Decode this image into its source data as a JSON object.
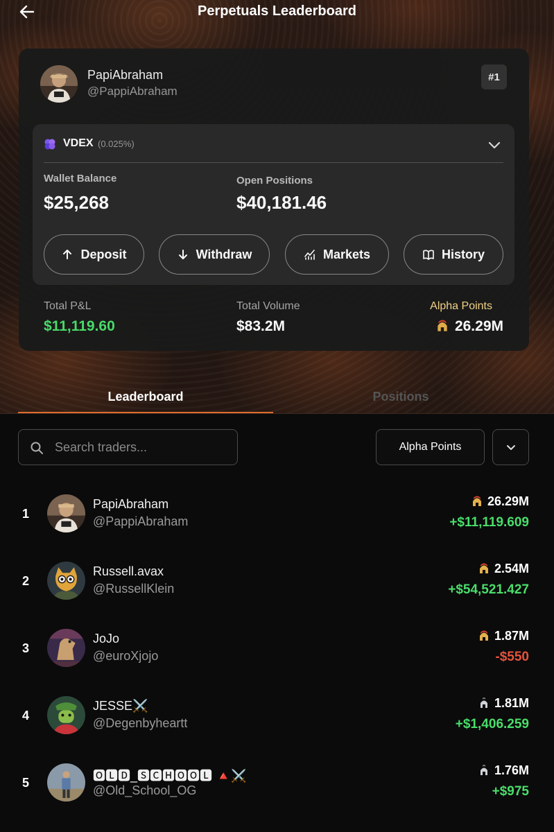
{
  "header": {
    "title": "Perpetuals Leaderboard"
  },
  "profile": {
    "name": "PapiAbraham",
    "handle": "@PappiAbraham",
    "rank": "#1",
    "exchange": {
      "name": "VDEX",
      "fee": "(0.025%)"
    },
    "wallet_balance": {
      "label": "Wallet Balance",
      "value": "$25,268"
    },
    "open_positions": {
      "label": "Open Positions",
      "value": "$40,181.46"
    },
    "actions": [
      {
        "label": "Deposit",
        "icon": "arrow-up-icon"
      },
      {
        "label": "Withdraw",
        "icon": "arrow-down-icon"
      },
      {
        "label": "Markets",
        "icon": "chart-icon"
      },
      {
        "label": "History",
        "icon": "book-icon"
      }
    ],
    "summary": {
      "pnl": {
        "label": "Total P&L",
        "value": "$11,119.60"
      },
      "volume": {
        "label": "Total Volume",
        "value": "$83.2M"
      },
      "alpha": {
        "label": "Alpha Points",
        "value": "26.29M"
      }
    }
  },
  "tabs": [
    {
      "label": "Leaderboard",
      "active": true
    },
    {
      "label": "Positions",
      "active": false
    }
  ],
  "search": {
    "placeholder": "Search traders..."
  },
  "sort": {
    "selected": "Alpha Points"
  },
  "leaderboard": [
    {
      "rank": "1",
      "name": "PapiAbraham",
      "handle": "@PappiAbraham",
      "points": "26.29M",
      "pnl": "+$11,119.609",
      "tier": "gold",
      "pnl_sign": "positive"
    },
    {
      "rank": "2",
      "name": "Russell.avax",
      "handle": "@RussellKlein",
      "points": "2.54M",
      "pnl": "+$54,521.427",
      "tier": "gold",
      "pnl_sign": "positive"
    },
    {
      "rank": "3",
      "name": "JoJo",
      "handle": "@euroXjojo",
      "points": "1.87M",
      "pnl": "-$550",
      "tier": "gold",
      "pnl_sign": "negative"
    },
    {
      "rank": "4",
      "name": "JESSE⚔️",
      "handle": "@Degenbyheartt",
      "points": "1.81M",
      "pnl": "+$1,406.259",
      "tier": "silver",
      "pnl_sign": "positive"
    },
    {
      "rank": "5",
      "name": "🅾🅻🅳_🆂🅲🅷🅾🅾🅻 🔺⚔️",
      "handle": "@Old_School_OG",
      "points": "1.76M",
      "pnl": "+$975",
      "tier": "silver",
      "pnl_sign": "positive"
    }
  ],
  "colors": {
    "positive": "#4ade6b",
    "negative": "#e5533d",
    "alpha_label": "#f5d68a",
    "accent": "#e06a2e"
  }
}
